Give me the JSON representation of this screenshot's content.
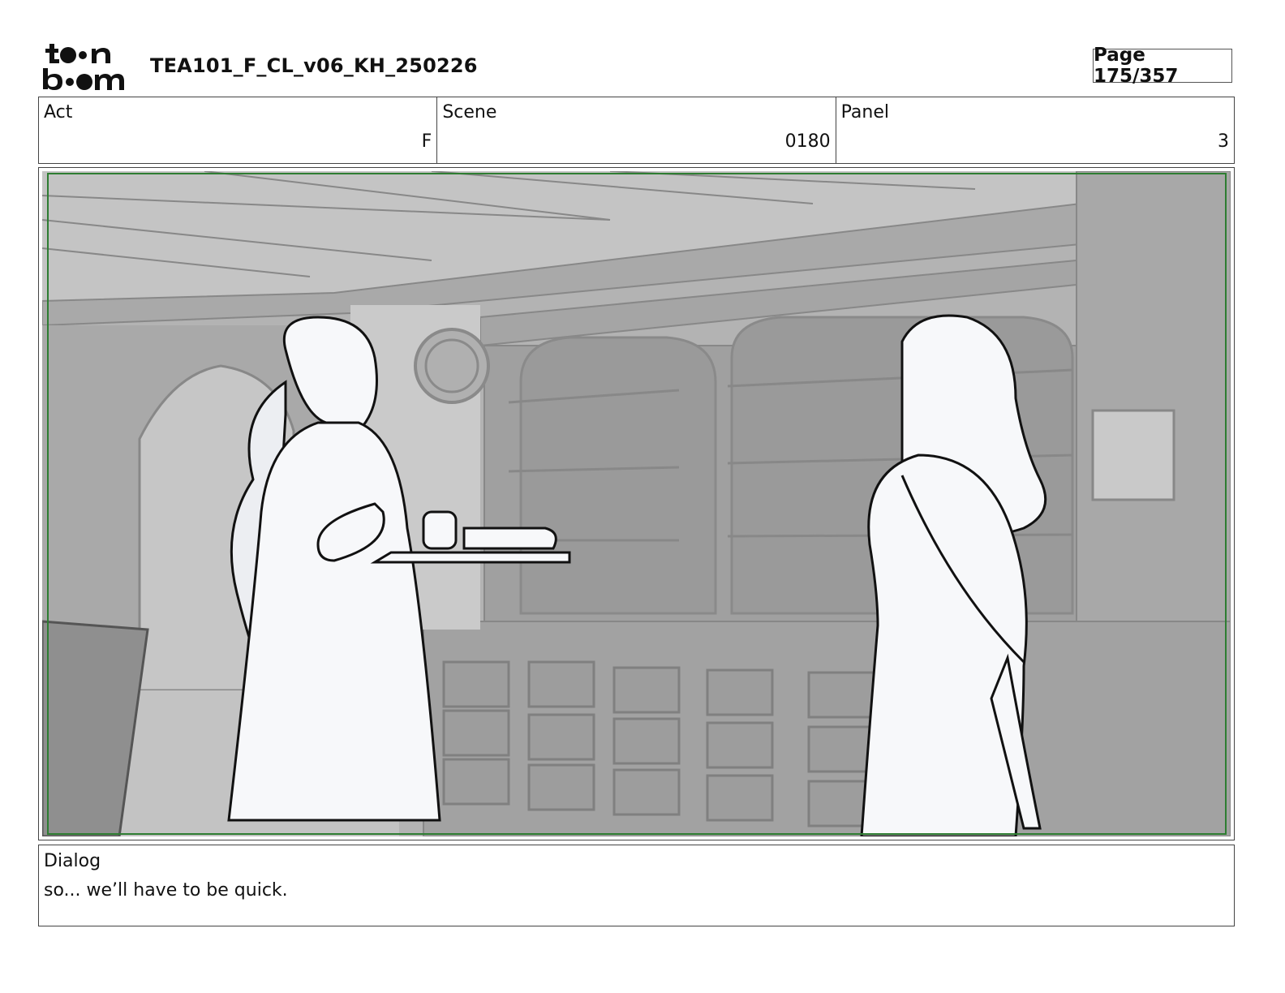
{
  "header": {
    "logo_text_top": "toon",
    "logo_text_bottom": "boom",
    "title": "TEA101_F_CL_v06_KH_250226",
    "page": "Page 175/357"
  },
  "info": {
    "act_label": "Act",
    "act_value": "F",
    "scene_label": "Scene",
    "scene_value": "0180",
    "panel_label": "Panel",
    "panel_value": "3"
  },
  "panel": {
    "safe_frame_color": "#2e7d32",
    "background_gray": "#b9b9b9"
  },
  "dialog": {
    "label": "Dialog",
    "text": "so... we’ll have to be quick."
  }
}
